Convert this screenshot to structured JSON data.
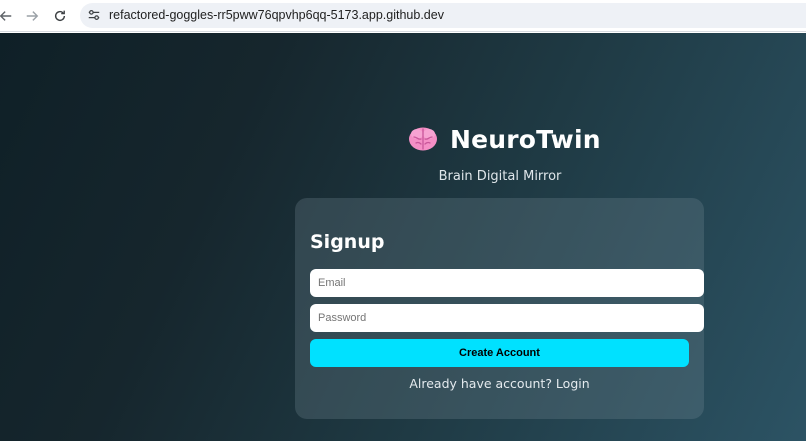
{
  "browser": {
    "url": "refactored-goggles-rr5pww76qpvhp6qq-5173.app.github.dev",
    "icons": {
      "back": "arrow-left-icon",
      "forward": "arrow-right-icon",
      "reload": "reload-icon",
      "site_info": "tune-icon"
    }
  },
  "brand": {
    "icon": "brain-icon",
    "title": "NeuroTwin",
    "tagline": "Brain Digital Mirror"
  },
  "signup": {
    "title": "Signup",
    "email_placeholder": "Email",
    "password_placeholder": "Password",
    "submit_label": "Create Account",
    "login_link": "Already have account? Login"
  },
  "colors": {
    "accent": "#00e1ff",
    "background_start": "#0f2027",
    "background_end": "#2c5364",
    "brain": "#f58fc6"
  }
}
